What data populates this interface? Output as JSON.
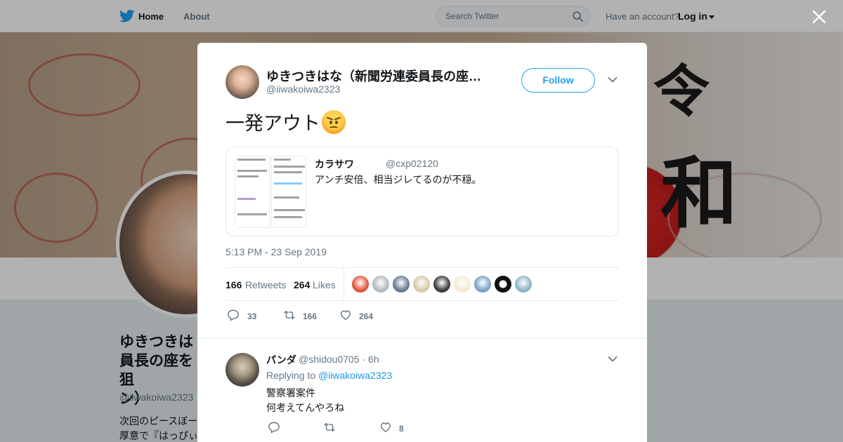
{
  "topbar": {
    "home_label": "Home",
    "about_label": "About",
    "search_placeholder": "Search Twitter",
    "have_account_text": "Have an account?",
    "login_label": "Log in"
  },
  "background_profile": {
    "name": "ゆきつきは\n員長の座を狙\nン）",
    "handle": "@iiwakoiwa2323",
    "bio": "次回のピースぼー\n厚意で『はっぴぃ"
  },
  "banner": {
    "kanji_top": "令",
    "kanji_bottom": "和"
  },
  "tweet": {
    "author_name": "ゆきつきはな（新聞労連委員長の座…",
    "author_handle": "@iiwakoiwa2323",
    "follow_label": "Follow",
    "text": "一発アウト",
    "emoji": "angry-face",
    "quoted": {
      "name": "カラサワ",
      "handle": "@cxp02120",
      "text": "アンチ安倍、相当ジレてるのが不穏。"
    },
    "timestamp": "5:13 PM - 23 Sep 2019",
    "retweets_count": "166",
    "retweets_label": "Retweets",
    "likes_count": "264",
    "likes_label": "Likes",
    "liker_colors": [
      "#e0553a",
      "#b0b8c0",
      "#6a7a8f",
      "#d9c7a9",
      "#3b3b3b",
      "#f4ead0",
      "#7aa3c8",
      "#111111",
      "#8db4c7"
    ],
    "actions": {
      "replies": "33",
      "retweets": "166",
      "likes": "264"
    }
  },
  "reply": {
    "name": "パンダ",
    "handle_time": "@shidou0705 · 6h",
    "replying_prefix": "Replying to",
    "replying_to": "@iiwakoiwa2323",
    "text_line1": "警察署案件",
    "text_line2": "何考えてんやろね",
    "likes": "8"
  },
  "colors": {
    "twitter_blue": "#1da1f2",
    "link_blue": "#1b95e0",
    "muted_gray": "#657786"
  }
}
